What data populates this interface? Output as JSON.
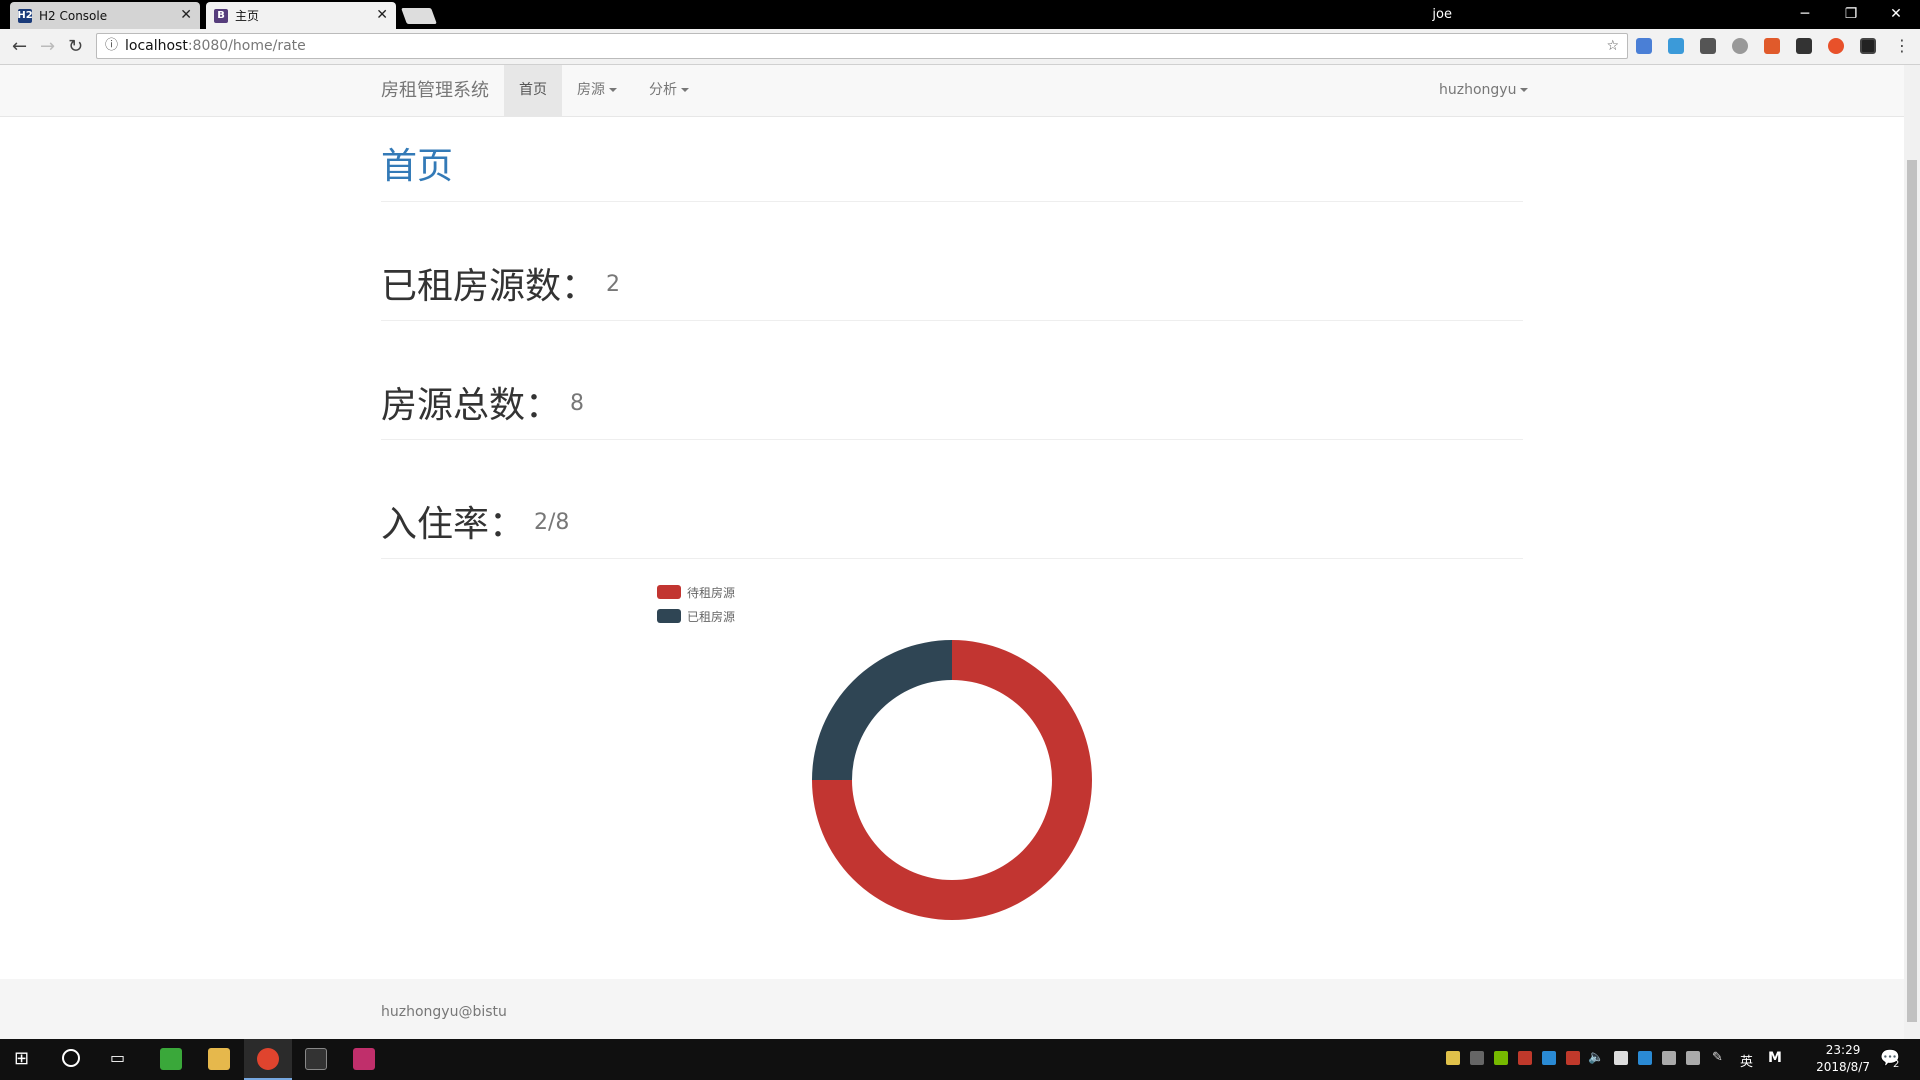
{
  "browser": {
    "tabs": [
      {
        "title": "H2 Console",
        "favicon": "H2"
      },
      {
        "title": "主页",
        "favicon": "B"
      }
    ],
    "user": "joe",
    "url_host": "localhost",
    "url_path": ":8080/home/rate"
  },
  "navbar": {
    "brand": "房租管理系统",
    "items": [
      {
        "label": "首页",
        "active": true
      },
      {
        "label": "房源",
        "dropdown": true
      },
      {
        "label": "分析",
        "dropdown": true
      }
    ],
    "user_menu": "huzhongyu"
  },
  "page": {
    "title": "首页",
    "stats": [
      {
        "label": "已租房源数：",
        "value": "2"
      },
      {
        "label": "房源总数：",
        "value": "8"
      },
      {
        "label": "入住率：",
        "value": "2/8"
      }
    ]
  },
  "chart_data": {
    "type": "pie",
    "categories": [
      "待租房源",
      "已租房源"
    ],
    "values": [
      6,
      2
    ],
    "colors": [
      "#c23531",
      "#2f4554"
    ],
    "legend": "top-left",
    "style": "donut"
  },
  "footer": {
    "text": "huzhongyu@bistu"
  },
  "taskbar": {
    "time": "23:29",
    "date": "2018/8/7",
    "ime": "英",
    "notifications": "2"
  }
}
